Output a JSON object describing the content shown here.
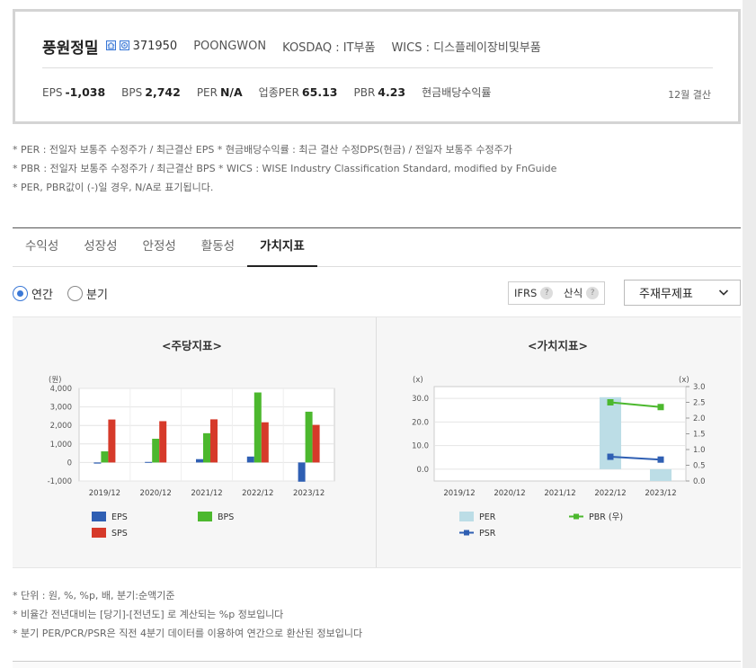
{
  "company": {
    "name": "풍원정밀",
    "code": "371950",
    "english_name": "POONGWON",
    "market": "KOSDAQ : IT부품",
    "wics": "WICS : 디스플레이장비및부품",
    "icons": [
      "home-icon",
      "ir-icon"
    ]
  },
  "metrics": [
    {
      "label": "EPS",
      "value": "-1,038"
    },
    {
      "label": "BPS",
      "value": "2,742"
    },
    {
      "label": "PER",
      "value": "N/A"
    },
    {
      "label": "업종PER",
      "value": "65.13"
    },
    {
      "label": "PBR",
      "value": "4.23"
    },
    {
      "label": "현금배당수익률",
      "value": ""
    }
  ],
  "fiscal_label": "12월 결산",
  "notes": [
    "* PER : 전일자 보통주 수정주가 / 최근결산 EPS * 현금배당수익률 : 최근 결산 수정DPS(현금) / 전일자 보통주 수정주가",
    "* PBR : 전일자 보통주 수정주가 / 최근결산 BPS * WICS : WISE Industry Classification Standard, modified by FnGuide",
    "* PER, PBR값이 (-)일 경우, N/A로 표기됩니다."
  ],
  "tabs": [
    "수익성",
    "성장성",
    "안정성",
    "활동성",
    "가치지표"
  ],
  "active_tab": "가치지표",
  "period": {
    "annual": "연간",
    "quarter": "분기",
    "selected": "annual"
  },
  "buttons": {
    "ifrs": "IFRS",
    "calc": "산식",
    "help": "?"
  },
  "select": {
    "value": "주재무제표"
  },
  "footnotes": [
    "* 단위 : 원, %, %p, 배, 분기:순액기준",
    "* 비율간 전년대비는 [당기]-[전년도] 로 계산되는 %p 정보입니다",
    "* 분기 PER/PCR/PSR은 직전 4분기 데이터를 이용하여 연간으로 환산된 정보입니다"
  ],
  "chart_data": [
    {
      "type": "bar",
      "title": "<주당지표>",
      "ylabel": "(원)",
      "categories": [
        "2019/12",
        "2020/12",
        "2021/12",
        "2022/12",
        "2023/12"
      ],
      "ylim": [
        -1000,
        4000
      ],
      "yticks": [
        "4,000",
        "3,000",
        "2,000",
        "1,000",
        "0",
        "-1,000"
      ],
      "series": [
        {
          "name": "EPS",
          "color": "#2f5fb3",
          "values": [
            -60,
            30,
            180,
            320,
            -1038
          ]
        },
        {
          "name": "BPS",
          "color": "#4cb82e",
          "values": [
            600,
            1280,
            1580,
            3780,
            2742
          ]
        },
        {
          "name": "SPS",
          "color": "#d63a2a",
          "values": [
            2320,
            2230,
            2330,
            2170,
            2030
          ]
        }
      ],
      "legend": "bottom"
    },
    {
      "type": "bar+line",
      "title": "<가치지표>",
      "ylabel_left": "(x)",
      "ylabel_right": "(x)",
      "categories": [
        "2019/12",
        "2020/12",
        "2021/12",
        "2022/12",
        "2023/12"
      ],
      "ylim_left": [
        -5,
        35
      ],
      "yticks_left": [
        "30.0",
        "20.0",
        "10.0",
        "0.0"
      ],
      "ylim_right": [
        0,
        3.0
      ],
      "yticks_right": [
        "3.0",
        "2.5",
        "2.0",
        "1.5",
        "1.0",
        "0.5",
        "0.0"
      ],
      "series": [
        {
          "name": "PER",
          "kind": "bar",
          "axis": "left",
          "color": "#bcdde6",
          "values": [
            null,
            null,
            null,
            30.5,
            -5
          ]
        },
        {
          "name": "PBR (우)",
          "kind": "line",
          "axis": "right",
          "color": "#4cb82e",
          "values": [
            null,
            null,
            null,
            2.5,
            2.35
          ]
        },
        {
          "name": "PSR",
          "kind": "line",
          "axis": "right",
          "color": "#2f5fb3",
          "values": [
            null,
            null,
            null,
            0.77,
            0.68
          ]
        }
      ],
      "legend": "bottom"
    }
  ]
}
